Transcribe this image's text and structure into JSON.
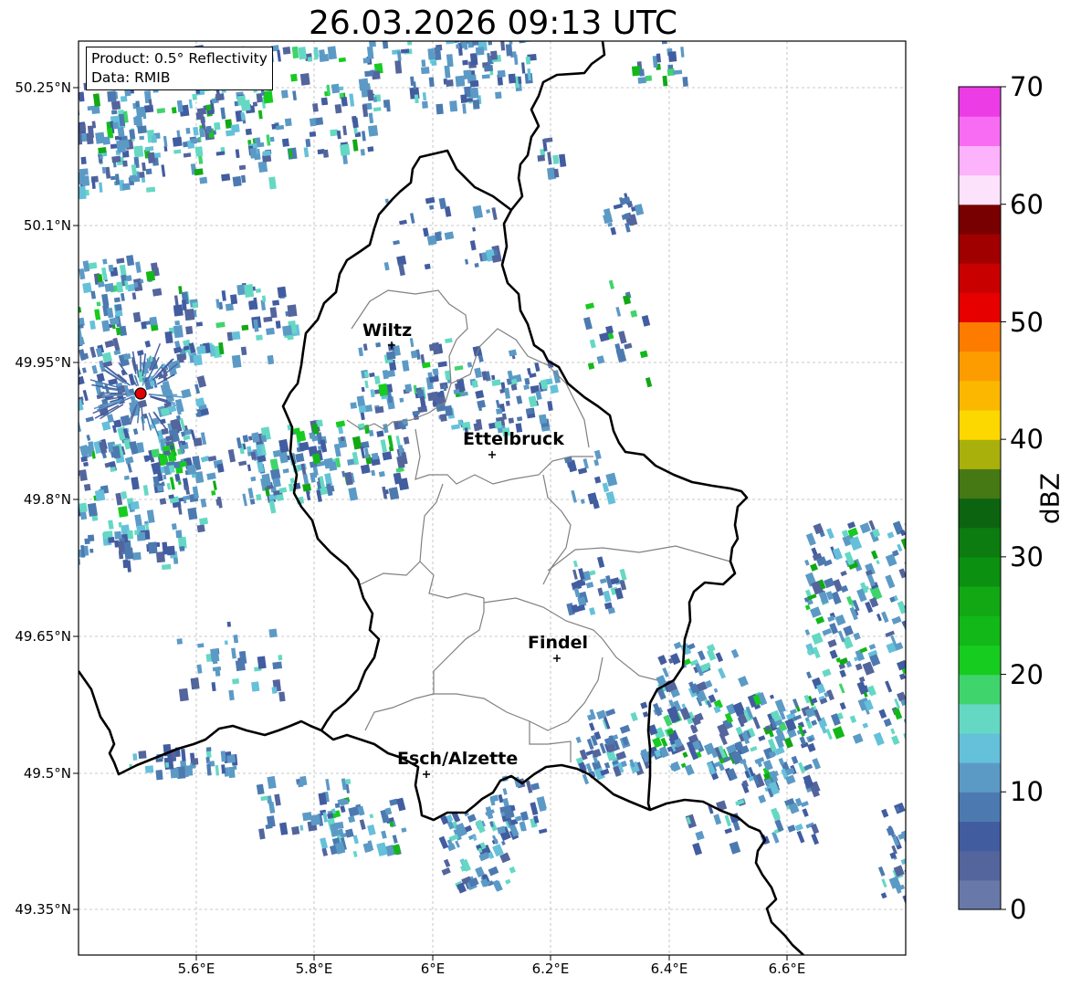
{
  "title": "26.03.2026 09:13 UTC",
  "info": {
    "product": "Product: 0.5° Reflectivity",
    "data": "Data: RMIB"
  },
  "axes": {
    "lat_ticks": [
      "50.25°N",
      "50.1°N",
      "49.95°N",
      "49.8°N",
      "49.65°N",
      "49.5°N",
      "49.35°N"
    ],
    "lon_ticks": [
      "5.6°E",
      "5.8°E",
      "6°E",
      "6.2°E",
      "6.4°E",
      "6.6°E"
    ],
    "grid": true
  },
  "cities": [
    {
      "name": "Wiltz"
    },
    {
      "name": "Ettelbruck"
    },
    {
      "name": "Findel"
    },
    {
      "name": "Esch/Alzette"
    }
  ],
  "radar_site": {
    "marker_color": "#e30000"
  },
  "colorbar": {
    "label": "dBZ",
    "min": 0,
    "max": 70,
    "ticks": [
      "0",
      "10",
      "20",
      "30",
      "40",
      "50",
      "60",
      "70"
    ],
    "colors": [
      "#6878a8",
      "#53659c",
      "#425ca0",
      "#4c7ab0",
      "#5c9ac6",
      "#65c0da",
      "#65d8c4",
      "#40d46c",
      "#16cc1e",
      "#12b818",
      "#12a814",
      "#0c9010",
      "#0c7c10",
      "#0c6410",
      "#467814",
      "#a9b00c",
      "#fdd800",
      "#fcb800",
      "#fc9c00",
      "#fd7c00",
      "#e60000",
      "#c80000",
      "#a00000",
      "#780000",
      "#fde2fc",
      "#fdb2fc",
      "#f86cf3",
      "#ec3ce6"
    ]
  }
}
